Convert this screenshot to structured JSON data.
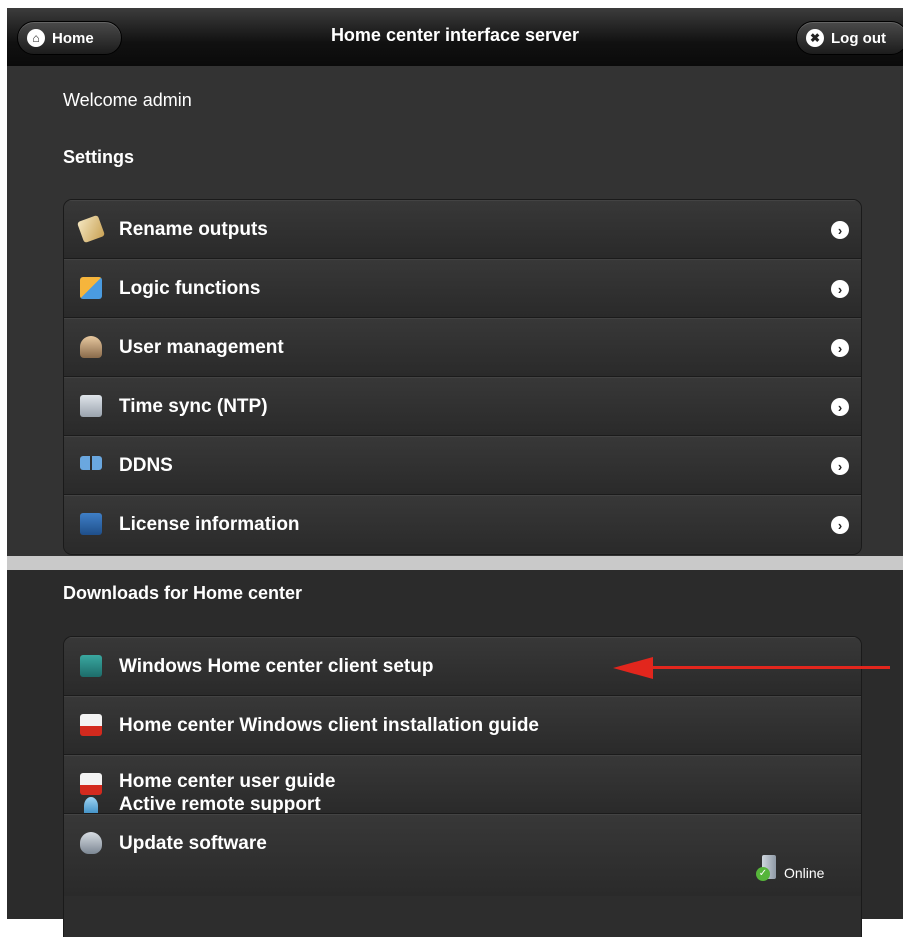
{
  "header": {
    "title": "Home center interface server",
    "home_label": "Home",
    "logout_label": "Log out"
  },
  "welcome": "Welcome admin",
  "settings": {
    "heading": "Settings",
    "items": [
      {
        "label": "Rename outputs",
        "icon": "rename-icon"
      },
      {
        "label": "Logic functions",
        "icon": "logic-blocks-icon"
      },
      {
        "label": "User management",
        "icon": "user-management-icon"
      },
      {
        "label": "Time sync (NTP)",
        "icon": "time-sync-icon"
      },
      {
        "label": "DDNS",
        "icon": "network-icon"
      },
      {
        "label": "License information",
        "icon": "license-icon"
      }
    ]
  },
  "downloads": {
    "heading": "Downloads for Home center",
    "items": [
      {
        "label": "Windows Home center client setup",
        "icon": "msi-installer-icon"
      },
      {
        "label": "Home center Windows client installation guide",
        "icon": "pdf-icon"
      },
      {
        "label": "Home center user guide",
        "icon": "pdf-icon"
      }
    ]
  },
  "support": {
    "remote_label": "Active remote support",
    "update_label": "Update software",
    "status": "Online"
  },
  "colors": {
    "panel": "#333333",
    "accent_arrow": "#e2261d"
  }
}
